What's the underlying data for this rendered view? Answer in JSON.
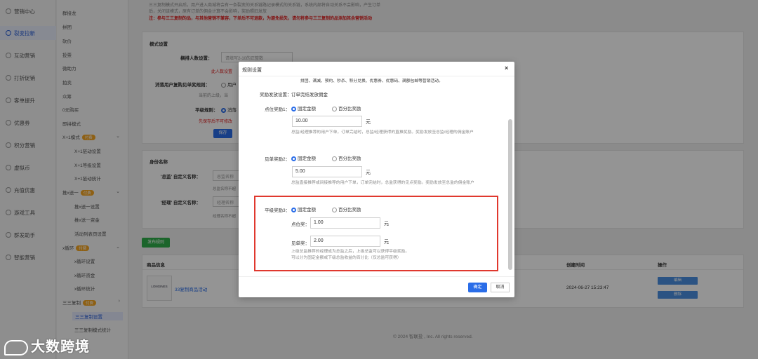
{
  "sidebar": {
    "items": [
      {
        "label": "营销中心",
        "icon": "marketing-icon"
      },
      {
        "label": "裂变拉新",
        "icon": "fission-icon",
        "active": true
      },
      {
        "label": "互动营销",
        "icon": "interaction-icon"
      },
      {
        "label": "打折促销",
        "icon": "discount-icon"
      },
      {
        "label": "客单提升",
        "icon": "order-value-icon"
      },
      {
        "label": "优惠券",
        "icon": "coupon-icon"
      },
      {
        "label": "积分营销",
        "icon": "points-icon"
      },
      {
        "label": "虚拟币",
        "icon": "coin-icon"
      },
      {
        "label": "充值优惠",
        "icon": "recharge-icon"
      },
      {
        "label": "游戏工具",
        "icon": "game-icon"
      },
      {
        "label": "群发助手",
        "icon": "broadcast-icon"
      },
      {
        "label": "智能营销",
        "icon": "smart-icon"
      }
    ]
  },
  "submenu": {
    "items": [
      "群接龙",
      "拼团",
      "砍价",
      "投票",
      "微助力",
      "拍卖",
      "众筹",
      "0元购买",
      "即拼模式"
    ],
    "xplus1": {
      "label": "X+1模式",
      "tag": "付费",
      "children": [
        "X+1链动设置",
        "X+1等级设置",
        "X+1链动统计"
      ]
    },
    "tuiyisong": {
      "label": "推x送一",
      "tag": "付费",
      "children": [
        "推x送一设置",
        "推x送一资金",
        "活动列表页设置"
      ]
    },
    "xloop": {
      "label": "x循环",
      "tag": "付费",
      "children": [
        "x循环设置",
        "x循环资金",
        "x循环统计"
      ]
    },
    "sansan": {
      "label": "三三复制",
      "tag": "付费",
      "children": [
        "三三复制设置",
        "三三复制模式统计"
      ]
    }
  },
  "background_page": {
    "top_text_1": "三三复制模式开启后，用户进入商城将会有一条裂变的关系链路记录模式的关系链，系统内部将自动关系不会影响，产生订单",
    "top_text_2": "后，关闭该模式，原有订单的佣金计算不会影响，奖励照旧发放",
    "top_warning": "注：参与三三复制的品，与其他营销不兼容，下单后不可退款，为避免损失，请勿将参与三三复制的品添加其余营销活动",
    "mode_section_title": "模式设置",
    "horizontal_count_label": "横排人数设置：",
    "horizontal_count_placeholder": "请填写2-10的正整数",
    "horizontal_count_hint": "此人数设置",
    "consume_label": "消落用户复购见单奖规则：",
    "consume_option": "用户",
    "consume_hint": "当前的上级，当",
    "level_rule_label": "平级规则：",
    "level_rule_option": "消落",
    "save_hint": "先保存后不可修改",
    "save_button": "保存",
    "identity_section_title": "身份名称",
    "zongjian_label": "'总监' 自定义名称：",
    "zongjian_placeholder": "总监名称",
    "zongjian_hint": "总监名称不超",
    "jingli_label": "'经理' 自定义名称：",
    "jingli_placeholder": "经理名称",
    "jingli_hint": "经理名称不超",
    "publish_button": "发布规则",
    "table": {
      "col_product": "商品信息",
      "col_created": "创建时间",
      "col_action": "操作",
      "rows": [
        {
          "logo_text": "LONGINES",
          "name": "33复制商品活动",
          "created": "2024-06-27 15:23:47",
          "edit": "编辑",
          "delete": "删除"
        }
      ]
    },
    "footer": "© 2024 智联投 , Inc. All rights reserved."
  },
  "modal": {
    "title": "规则设置",
    "close_symbol": "×",
    "top_red_text": "拼团、满减、预约、秒杀、积分兑换、优惠券、优惠码、满额包邮等营销活动。",
    "reward_release_label": "奖励发放设置：",
    "reward_release_value": "订单完结发放佣金",
    "opt_fixed": "固定金额",
    "opt_percent": "百分比奖励",
    "unit": "元",
    "point_reward": {
      "label": "点位奖励1：",
      "value": "10.00",
      "note": "总监/经理推荐的用户下单，订单完结时，总监/经理获得的直推奖励。奖励发放至总监/经理的佣金账户"
    },
    "order_reward": {
      "label": "见单奖励2：",
      "value": "5.00",
      "note": "总监直接推荐或间接推荐的用户下单，订单完结时，总监获得的见点奖励。奖励发放至总监的佣金账户"
    },
    "level_reward": {
      "label": "平级奖励3：",
      "point_label": "点位奖：",
      "point_value": "1.00",
      "order_label": "见单奖：",
      "order_value": "2.00",
      "note_1": "上级总监推荐的经理成为总监之后，上级总监可以获得平级奖励。",
      "note_2": "可以分为固定金额或下级总监收益的百分比（仅总监可获得）"
    },
    "confirm_button": "确定",
    "cancel_button": "取消"
  },
  "watermark": "大数跨境",
  "colors": {
    "accent": "#2a6de8",
    "highlight_border": "#e0382e",
    "warning": "#e02020"
  }
}
